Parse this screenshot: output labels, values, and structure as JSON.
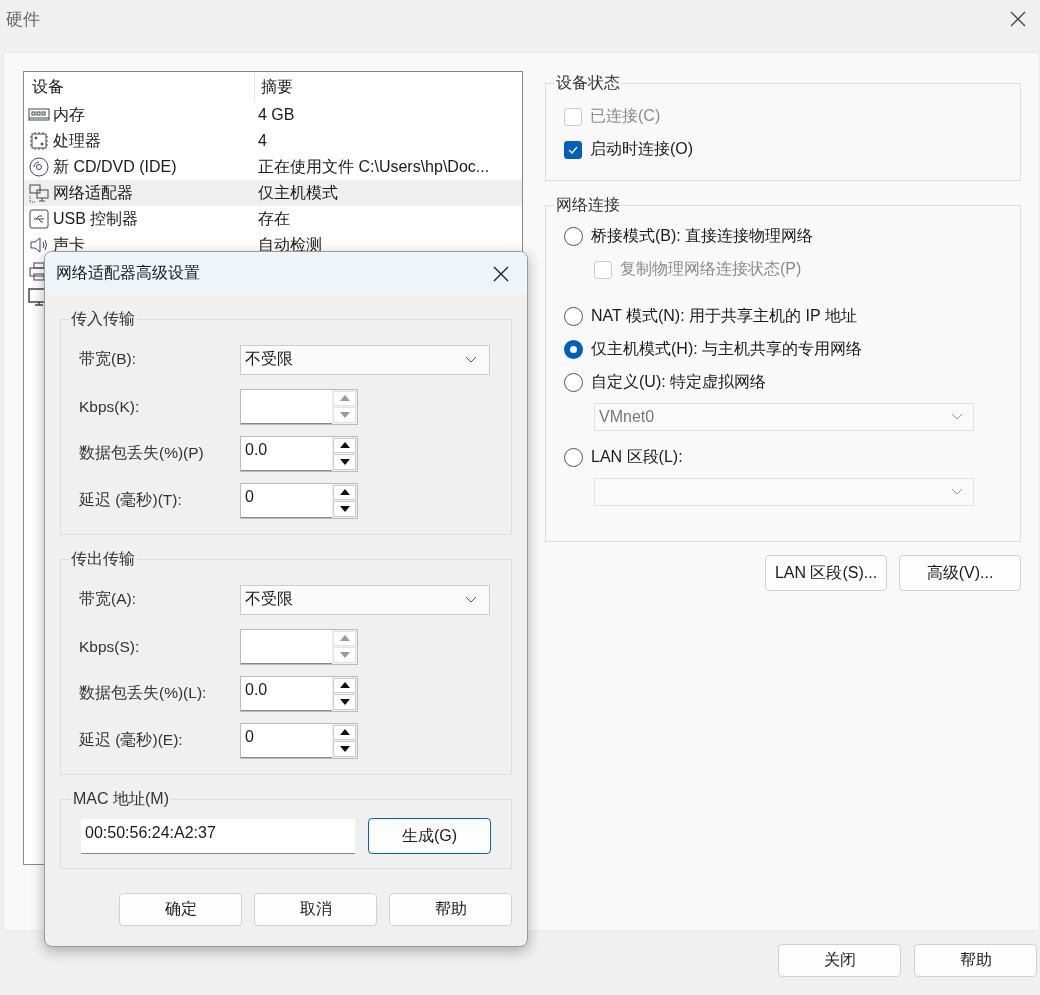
{
  "window": {
    "title": "硬件"
  },
  "device_table": {
    "columns": [
      "设备",
      "摘要"
    ],
    "rows": [
      {
        "kind": "memory",
        "device": "内存",
        "summary": "4 GB",
        "selected": false
      },
      {
        "kind": "processor",
        "device": "处理器",
        "summary": "4",
        "selected": false
      },
      {
        "kind": "disc",
        "device": "新 CD/DVD (IDE)",
        "summary": "正在使用文件 C:\\Users\\hp\\Doc...",
        "selected": false
      },
      {
        "kind": "network",
        "device": "网络适配器",
        "summary": "仅主机模式",
        "selected": true
      },
      {
        "kind": "usb",
        "device": "USB 控制器",
        "summary": "存在",
        "selected": false
      },
      {
        "kind": "sound",
        "device": "声卡",
        "summary": "自动检测",
        "selected": false
      },
      {
        "kind": "printer",
        "selected": false
      },
      {
        "kind": "display",
        "selected": false
      }
    ]
  },
  "device_status": {
    "title": "设备状态",
    "options": [
      {
        "label": "已连接(C)",
        "checked": false,
        "disabled": true
      },
      {
        "label": "启动时连接(O)",
        "checked": true,
        "disabled": false
      }
    ]
  },
  "network_connection": {
    "title": "网络连接",
    "items": [
      {
        "kind": "radio",
        "label": "桥接模式(B): 直接连接物理网络",
        "selected": false
      },
      {
        "kind": "checkbox",
        "label": "复制物理网络连接状态(P)",
        "checked": false,
        "disabled": true
      },
      {
        "kind": "radio",
        "label": "NAT 模式(N): 用于共享主机的 IP 地址",
        "selected": false
      },
      {
        "kind": "radio",
        "label": "仅主机模式(H): 与主机共享的专用网络",
        "selected": true
      },
      {
        "kind": "radio",
        "label": "自定义(U): 特定虚拟网络",
        "selected": false
      },
      {
        "kind": "dropdown",
        "value": "VMnet0",
        "disabled": true
      },
      {
        "kind": "radio",
        "label": "LAN 区段(L):",
        "selected": false
      },
      {
        "kind": "dropdown",
        "disabled": true
      }
    ]
  },
  "network_buttons": [
    "LAN 区段(S)...",
    "高级(V)..."
  ],
  "footer_buttons": [
    "关闭",
    "帮助"
  ],
  "dialog": {
    "title": "网络适配器高级设置",
    "groups": [
      {
        "title": "传入传输",
        "fields": [
          {
            "kind": "dropdown",
            "label": "带宽(B):",
            "value": "不受限"
          },
          {
            "kind": "spinner",
            "label": "Kbps(K):",
            "disabled": true
          },
          {
            "kind": "spinner",
            "label": "数据包丢失(%)(P)",
            "value": "0.0",
            "disabled": false
          },
          {
            "kind": "spinner",
            "label": "延迟 (毫秒)(T):",
            "value": "0",
            "disabled": false
          }
        ]
      },
      {
        "title": "传出传输",
        "fields": [
          {
            "kind": "dropdown",
            "label": "带宽(A):",
            "value": "不受限"
          },
          {
            "kind": "spinner",
            "label": "Kbps(S):",
            "disabled": true
          },
          {
            "kind": "spinner",
            "label": "数据包丢失(%)(L):",
            "value": "0.0",
            "disabled": false
          },
          {
            "kind": "spinner",
            "label": "延迟 (毫秒)(E):",
            "value": "0",
            "disabled": false
          }
        ]
      }
    ],
    "mac": {
      "title": "MAC 地址(M)",
      "value": "00:50:56:24:A2:37",
      "button": "生成(G)"
    },
    "buttons": [
      "确定",
      "取消",
      "帮助"
    ]
  }
}
